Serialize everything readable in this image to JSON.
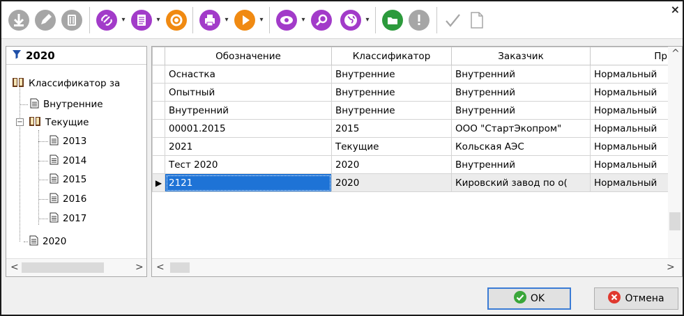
{
  "toolbar": {
    "buttons": [
      {
        "name": "download-icon",
        "color": "#9a9a9a"
      },
      {
        "name": "edit-pencil-icon",
        "color": "#9a9a9a"
      },
      {
        "name": "delete-bin-icon",
        "color": "#9a9a9a"
      },
      {
        "name": "link-icon",
        "color": "#a23bc9"
      },
      {
        "name": "document-list-icon",
        "color": "#a23bc9"
      },
      {
        "name": "refresh-cycle-icon",
        "color": "#f08a12"
      },
      {
        "name": "print-icon",
        "color": "#a23bc9"
      },
      {
        "name": "play-icon",
        "color": "#f08a12"
      },
      {
        "name": "eye-icon",
        "color": "#a23bc9"
      },
      {
        "name": "search-magnifier-icon",
        "color": "#a23bc9"
      },
      {
        "name": "globe-icon",
        "color": "#a23bc9"
      },
      {
        "name": "open-folder-icon",
        "color": "#2c9a3c"
      },
      {
        "name": "info-icon",
        "color": "#9a9a9a"
      },
      {
        "name": "checkmark-icon",
        "color": "#9a9a9a"
      },
      {
        "name": "blank-page-icon",
        "color": "#9a9a9a"
      }
    ],
    "close": "×"
  },
  "tree": {
    "header": "2020",
    "nodes": [
      {
        "label": "Классификатор за",
        "level": 0
      },
      {
        "label": "Внутренние",
        "level": 1
      },
      {
        "label": "Текущие",
        "level": 1
      },
      {
        "label": "2013",
        "level": 2
      },
      {
        "label": "2014",
        "level": 2
      },
      {
        "label": "2015",
        "level": 2
      },
      {
        "label": "2016",
        "level": 2
      },
      {
        "label": "2017",
        "level": 2
      },
      {
        "label": "2020",
        "level": 1
      }
    ],
    "expander_minus": "−",
    "scroll_left": "<",
    "scroll_right": ">"
  },
  "grid": {
    "columns": [
      "Обозначение",
      "Классификатор",
      "Заказчик",
      "Пр"
    ],
    "rows": [
      [
        "Оснастка",
        "Внутренние",
        "Внутренний",
        "Нормальный"
      ],
      [
        "Опытный",
        "Внутренние",
        "Внутренний",
        "Нормальный"
      ],
      [
        "Внутренний",
        "Внутренние",
        "Внутренний",
        "Нормальный"
      ],
      [
        "00001.2015",
        "2015",
        "ООО \"СтартЭкопром\"",
        "Нормальный"
      ],
      [
        "2021",
        "Текущие",
        "Кольская АЭС",
        "Нормальный"
      ],
      [
        "Тест 2020",
        "2020",
        "Внутренний",
        "Нормальный"
      ],
      [
        "2121",
        "2020",
        "Кировский завод по о(",
        "Нормальный"
      ]
    ],
    "selected_row": 6,
    "row_indicator": "▶",
    "scroll_up": "^",
    "scroll_left": "<",
    "scroll_right": ">"
  },
  "footer": {
    "ok_label": "OK",
    "cancel_label": "Отмена",
    "ok_color": "#3aa63a",
    "cancel_color": "#e0392f"
  }
}
